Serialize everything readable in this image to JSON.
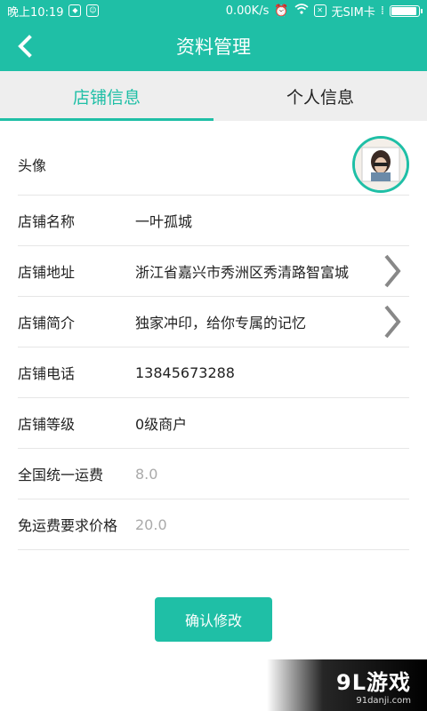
{
  "status_bar": {
    "time": "晚上10:19",
    "speed": "0.00K/s",
    "sim": "无SIM卡"
  },
  "header": {
    "title": "资料管理",
    "back_icon": "back-arrow-icon"
  },
  "tabs": [
    {
      "label": "店铺信息",
      "active": true
    },
    {
      "label": "个人信息",
      "active": false
    }
  ],
  "form": {
    "avatar_label": "头像",
    "rows": [
      {
        "label": "店铺名称",
        "value": "一叶孤城"
      },
      {
        "label": "店铺地址",
        "value": "浙江省嘉兴市秀洲区秀清路智富城"
      },
      {
        "label": "店铺简介",
        "value": "独家冲印，给你专属的记忆"
      },
      {
        "label": "店铺电话",
        "value": "13845673288"
      },
      {
        "label": "店铺等级",
        "value": "0级商户"
      },
      {
        "label": "全国统一运费",
        "value": "8.0"
      },
      {
        "label": "免运费要求价格",
        "value": "20.0"
      }
    ]
  },
  "actions": {
    "confirm_label": "确认修改"
  },
  "watermark": {
    "logo": "9L游戏",
    "site": "91danji.com"
  },
  "colors": {
    "accent": "#1fbfa6",
    "tab_bg": "#eeeeee",
    "muted_text": "#aaaaaa"
  }
}
